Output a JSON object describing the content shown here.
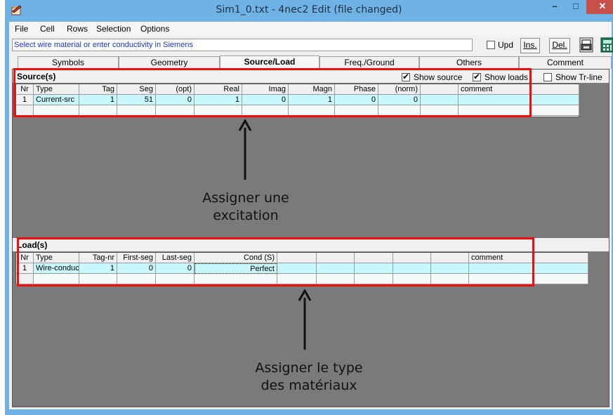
{
  "window": {
    "title": "Sim1_0.txt - 4nec2 Edit (file changed)",
    "minimize": "–",
    "maximize": "□",
    "close": "✕"
  },
  "menu": [
    "File",
    "Cell",
    "Rows",
    "Selection",
    "Options"
  ],
  "toolbar": {
    "hint": "Select wire material or enter conductivity in Siemens",
    "upd_label": "Upd",
    "ins_label": "Ins.",
    "del_label": "Del."
  },
  "tabs": [
    "Symbols",
    "Geometry",
    "Source/Load",
    "Freq./Ground",
    "Others",
    "Comment"
  ],
  "active_tab": "Source/Load",
  "sources": {
    "title": "Source(s)",
    "show_source": "Show source",
    "show_loads": "Show loads",
    "show_trline": "Show Tr-line",
    "columns": [
      "Nr",
      "Type",
      "Tag",
      "Seg",
      "(opt)",
      "Real",
      "Imag",
      "Magn",
      "Phase",
      "(norm)",
      "",
      "comment"
    ],
    "rows": [
      [
        "1",
        "Current-src",
        "1",
        "51",
        "0",
        "1",
        "0",
        "1",
        "0",
        "0",
        "",
        ""
      ]
    ]
  },
  "loads": {
    "title": "Load(s)",
    "columns": [
      "Nr",
      "Type",
      "Tag-nr",
      "First-seg",
      "Last-seg",
      "Cond (S)",
      "",
      "",
      "",
      "",
      "",
      "comment"
    ],
    "rows": [
      [
        "1",
        "Wire-conduc",
        "1",
        "0",
        "0",
        "Perfect",
        "",
        "",
        "",
        "",
        "",
        ""
      ]
    ]
  },
  "annotations": {
    "excitation": [
      "Assigner une",
      "excitation"
    ],
    "material": [
      "Assigner le type",
      "des matériaux"
    ]
  },
  "colors": {
    "highlight": "#f20d0d",
    "row_fill": "#c8f8fc",
    "title_bar": "#6fb3e6",
    "hint_text": "#1a33c8"
  },
  "icons": {
    "app": "notepad-edit-icon",
    "printer": "printer-icon",
    "calculator": "calculator-icon"
  }
}
